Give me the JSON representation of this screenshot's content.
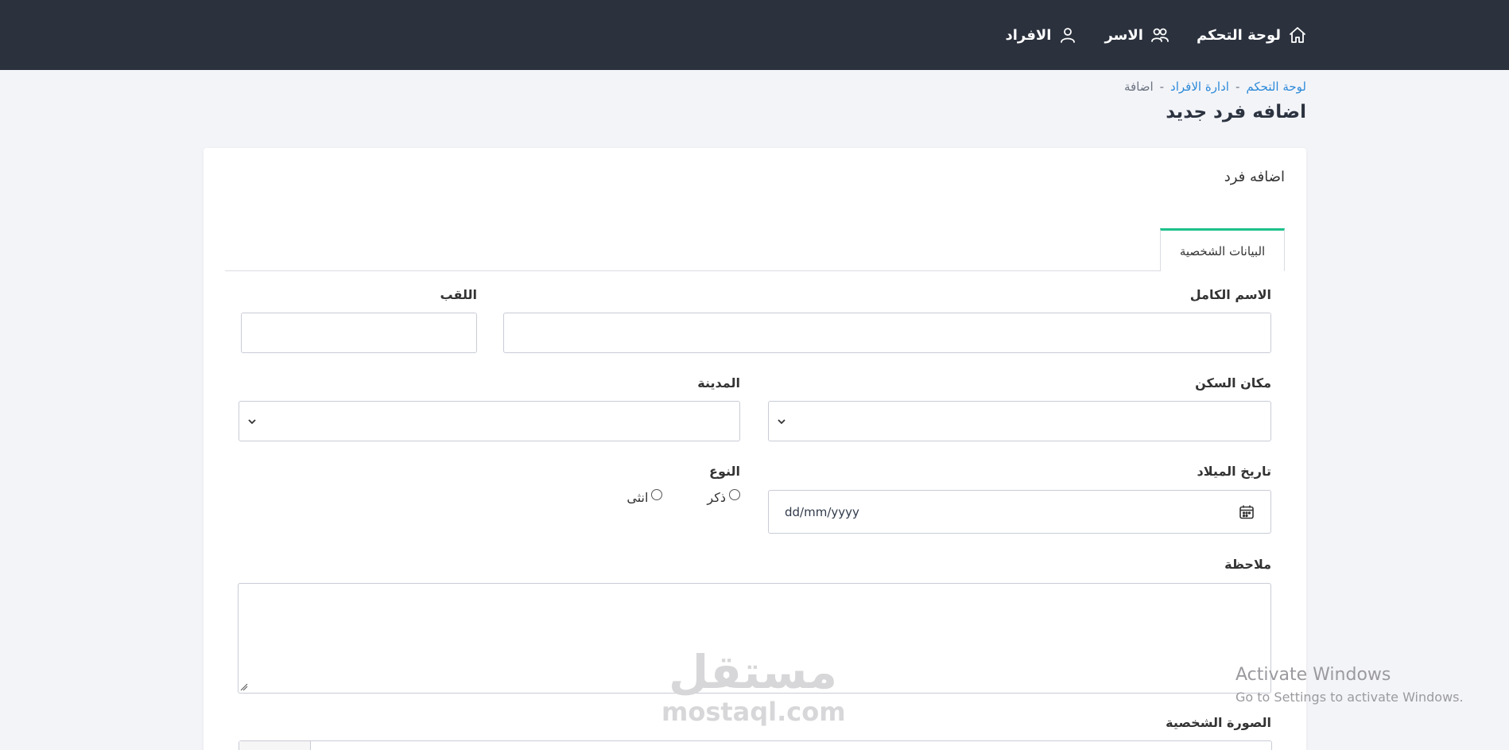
{
  "nav": {
    "items": [
      {
        "label": "لوحة التحكم",
        "icon": "home-icon"
      },
      {
        "label": "الاسر",
        "icon": "users-icon"
      },
      {
        "label": "الافراد",
        "icon": "user-icon"
      }
    ]
  },
  "breadcrumb": {
    "items": [
      "لوحة التحكم",
      "ادارة الافراد",
      "اضافة"
    ],
    "separator": "-"
  },
  "page": {
    "title": "اضافه فرد جديد"
  },
  "card": {
    "title": "اضافه فرد",
    "tab": "البيانات الشخصية"
  },
  "form": {
    "full_name": {
      "label": "الاسم الكامل",
      "value": ""
    },
    "nickname": {
      "label": "اللقب",
      "value": ""
    },
    "residence": {
      "label": "مكان السكن",
      "value": ""
    },
    "city": {
      "label": "المدينة",
      "value": ""
    },
    "birth_date": {
      "label": "تاريخ الميلاد",
      "placeholder": "dd/mm/yyyy"
    },
    "gender": {
      "label": "النوع",
      "options": [
        "ذكر",
        "انثى"
      ]
    },
    "note": {
      "label": "ملاحظة",
      "value": ""
    },
    "photo": {
      "label": "الصورة الشخصية"
    }
  },
  "watermark": {
    "ar": "مستقل",
    "en": "mostaql.com"
  },
  "windows": {
    "line1": "Activate Windows",
    "line2": "Go to Settings to activate Windows."
  },
  "colors": {
    "topbar": "#2b313d",
    "accent": "#1cc18a",
    "link": "#2d8ad8",
    "background": "#f3f4f8"
  }
}
